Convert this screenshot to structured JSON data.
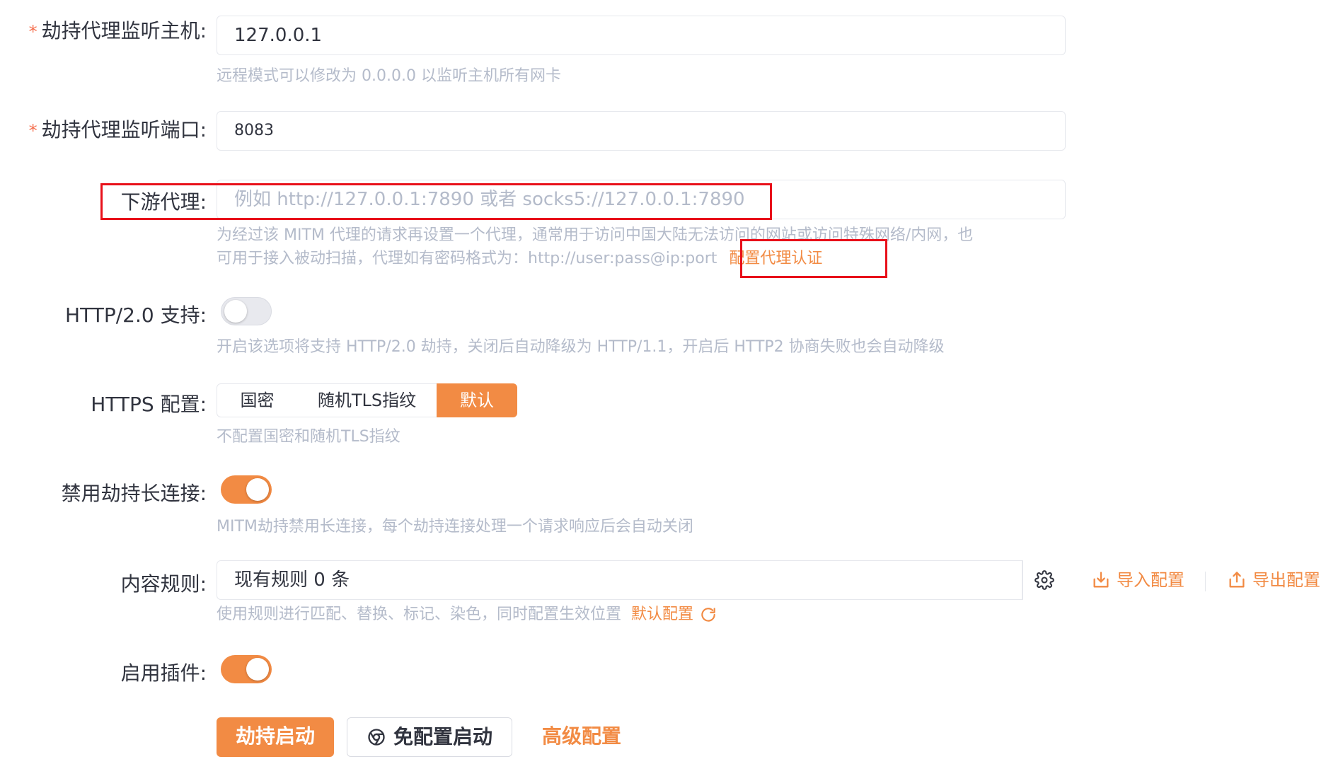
{
  "fields": {
    "host": {
      "label": "劫持代理监听主机:",
      "required_mark": "*",
      "value": "127.0.0.1",
      "help": "远程模式可以修改为 0.0.0.0 以监听主机所有网卡"
    },
    "port": {
      "label": "劫持代理监听端口:",
      "required_mark": "*",
      "value": "8083"
    },
    "downstream_proxy": {
      "label": "下游代理:",
      "placeholder": "例如 http://127.0.0.1:7890 或者 socks5://127.0.0.1:7890",
      "help_line1": "为经过该 MITM 代理的请求再设置一个代理，通常用于访问中国大陆无法访问的网站或访问特殊网络/内网，也",
      "help_line2": "可用于接入被动扫描，代理如有密码格式为：http://user:pass@ip:port",
      "auth_link": "配置代理认证"
    },
    "http2": {
      "label": "HTTP/2.0 支持:",
      "enabled": false,
      "help": "开启该选项将支持 HTTP/2.0 劫持，关闭后自动降级为 HTTP/1.1，开启后 HTTP2 协商失败也会自动降级"
    },
    "https": {
      "label": "HTTPS 配置:",
      "options": [
        "国密",
        "随机TLS指纹",
        "默认"
      ],
      "selected": "默认",
      "help": "不配置国密和随机TLS指纹"
    },
    "disable_keepalive": {
      "label": "禁用劫持长连接:",
      "enabled": true,
      "help": "MITM劫持禁用长连接，每个劫持连接处理一个请求响应后会自动关闭"
    },
    "content_rules": {
      "label": "内容规则:",
      "value": "现有规则 0 条",
      "import_label": "导入配置",
      "export_label": "导出配置",
      "help": "使用规则进行匹配、替换、标记、染色，同时配置生效位置",
      "default_link": "默认配置"
    },
    "plugins": {
      "label": "启用插件:",
      "enabled": true
    }
  },
  "buttons": {
    "start": "劫持启动",
    "no_config_start": "免配置启动",
    "advanced": "高级配置"
  },
  "colors": {
    "accent": "#f28b44",
    "highlight_box": "#e8101a",
    "required": "#f5704f"
  },
  "icons": {
    "settings": "gear-icon",
    "import": "import-icon",
    "export": "export-icon",
    "reset": "refresh-icon",
    "chrome": "chrome-icon"
  }
}
